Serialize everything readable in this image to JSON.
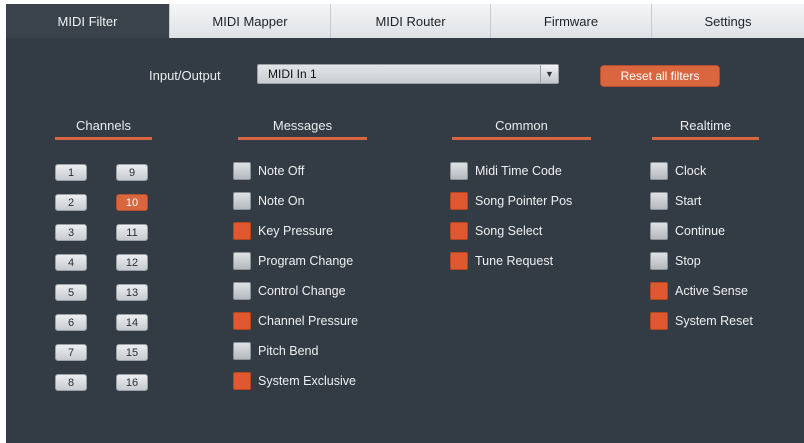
{
  "tabs": [
    "MIDI Filter",
    "MIDI Mapper",
    "MIDI Router",
    "Firmware",
    "Settings"
  ],
  "active_tab": 0,
  "io": {
    "label": "Input/Output",
    "value": "MIDI In 1",
    "arrow": "▼"
  },
  "reset_label": "Reset all filters",
  "headers": {
    "channels": "Channels",
    "messages": "Messages",
    "common": "Common",
    "realtime": "Realtime"
  },
  "channels": [
    {
      "n": "1",
      "on": false
    },
    {
      "n": "2",
      "on": false
    },
    {
      "n": "3",
      "on": false
    },
    {
      "n": "4",
      "on": false
    },
    {
      "n": "5",
      "on": false
    },
    {
      "n": "6",
      "on": false
    },
    {
      "n": "7",
      "on": false
    },
    {
      "n": "8",
      "on": false
    },
    {
      "n": "9",
      "on": false
    },
    {
      "n": "10",
      "on": true
    },
    {
      "n": "11",
      "on": false
    },
    {
      "n": "12",
      "on": false
    },
    {
      "n": "13",
      "on": false
    },
    {
      "n": "14",
      "on": false
    },
    {
      "n": "15",
      "on": false
    },
    {
      "n": "16",
      "on": false
    }
  ],
  "messages": [
    {
      "label": "Note Off",
      "on": false
    },
    {
      "label": "Note On",
      "on": false
    },
    {
      "label": "Key Pressure",
      "on": true
    },
    {
      "label": "Program Change",
      "on": false
    },
    {
      "label": "Control Change",
      "on": false
    },
    {
      "label": "Channel Pressure",
      "on": true
    },
    {
      "label": "Pitch Bend",
      "on": false
    },
    {
      "label": "System Exclusive",
      "on": true
    }
  ],
  "common": [
    {
      "label": "Midi Time Code",
      "on": false
    },
    {
      "label": "Song Pointer Pos",
      "on": true
    },
    {
      "label": "Song Select",
      "on": true
    },
    {
      "label": "Tune Request",
      "on": true
    }
  ],
  "realtime": [
    {
      "label": "Clock",
      "on": false
    },
    {
      "label": "Start",
      "on": false
    },
    {
      "label": "Continue",
      "on": false
    },
    {
      "label": "Stop",
      "on": false
    },
    {
      "label": "Active Sense",
      "on": true
    },
    {
      "label": "System Reset",
      "on": true
    }
  ],
  "colors": {
    "accent": "#d9663e",
    "panel": "#333c45"
  }
}
